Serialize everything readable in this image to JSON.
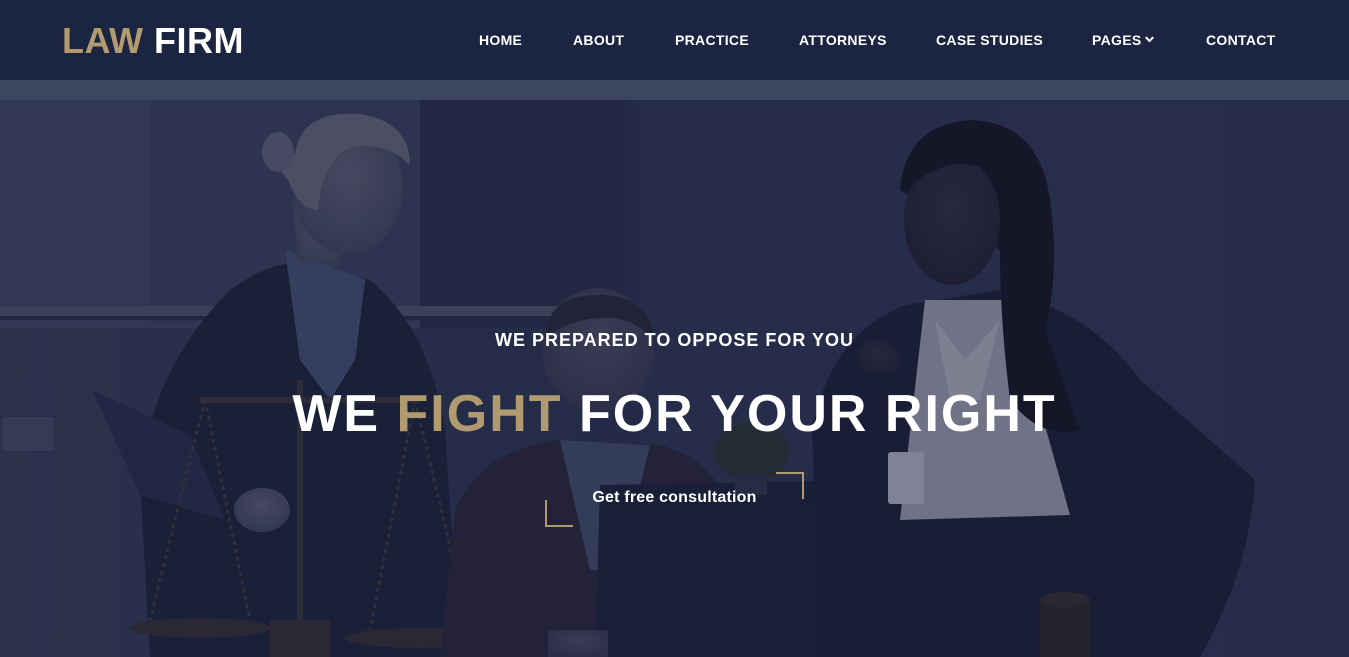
{
  "brand": {
    "logo_part1": "LAW",
    "logo_part2": "FIRM",
    "accent_color": "#b19a6f",
    "nav_bg_color": "#1b2440"
  },
  "nav": {
    "items": [
      {
        "label": "HOME"
      },
      {
        "label": "ABOUT"
      },
      {
        "label": "PRACTICE"
      },
      {
        "label": "ATTORNEYS"
      },
      {
        "label": "CASE STUDIES"
      },
      {
        "label": "PAGES",
        "icon": "chevron-down-icon"
      },
      {
        "label": "CONTACT"
      }
    ]
  },
  "hero": {
    "eyebrow": "WE PREPARED TO OPPOSE FOR YOU",
    "title_part1": "WE",
    "title_accent": "FIGHT",
    "title_part2": "FOR YOUR RIGHT",
    "cta_label": "Get free consultation"
  }
}
